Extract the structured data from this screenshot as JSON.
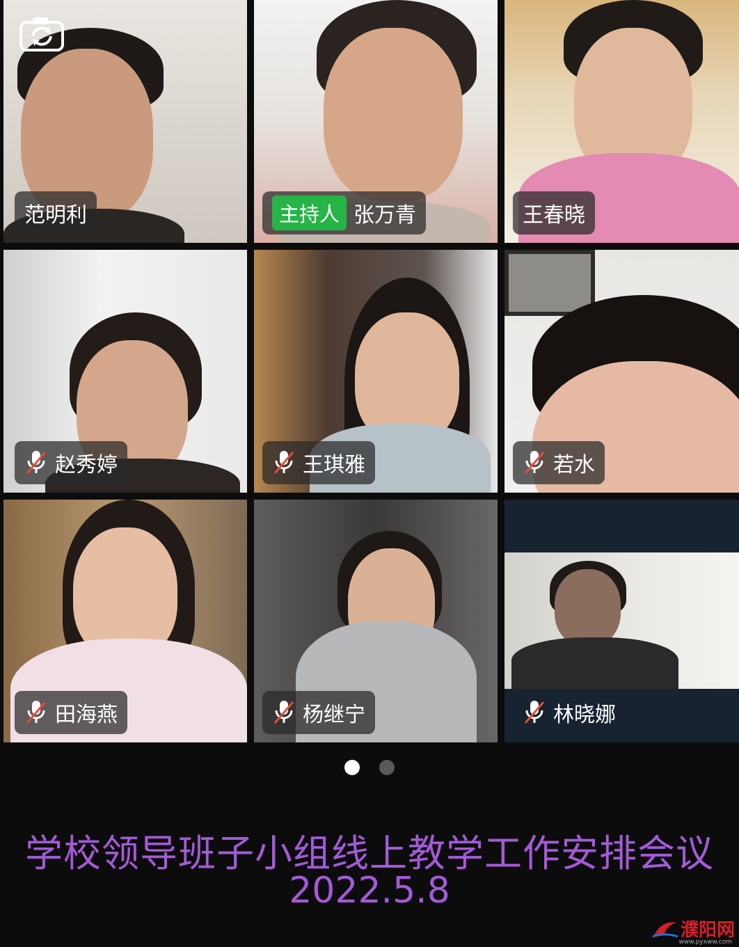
{
  "participants": [
    {
      "name": "范明利",
      "role": "",
      "muted": false
    },
    {
      "name": "张万青",
      "role": "主持人",
      "muted": false
    },
    {
      "name": "王春晓",
      "role": "",
      "muted": false
    },
    {
      "name": "赵秀婷",
      "role": "",
      "muted": true
    },
    {
      "name": "王琪雅",
      "role": "",
      "muted": true
    },
    {
      "name": "若水",
      "role": "",
      "muted": true
    },
    {
      "name": "田海燕",
      "role": "",
      "muted": true
    },
    {
      "name": "杨继宁",
      "role": "",
      "muted": true
    },
    {
      "name": "林晓娜",
      "role": "",
      "muted": true
    }
  ],
  "pager": {
    "pages": 2,
    "current": 1
  },
  "caption": {
    "title": "学校领导班子小组线上教学工作安排会议",
    "date": "2022.5.8"
  },
  "watermark": {
    "text": "濮阳网",
    "url": "www.pyxww.com"
  },
  "colors": {
    "background": "#0c0c0c",
    "caption": "#a35ad8",
    "host_badge": "#27b446",
    "muted_slash": "#e74c3c",
    "watermark": "#d4202a"
  },
  "icons": {
    "camera_switch": "camera-switch-icon",
    "muted": "mic-muted-icon"
  }
}
